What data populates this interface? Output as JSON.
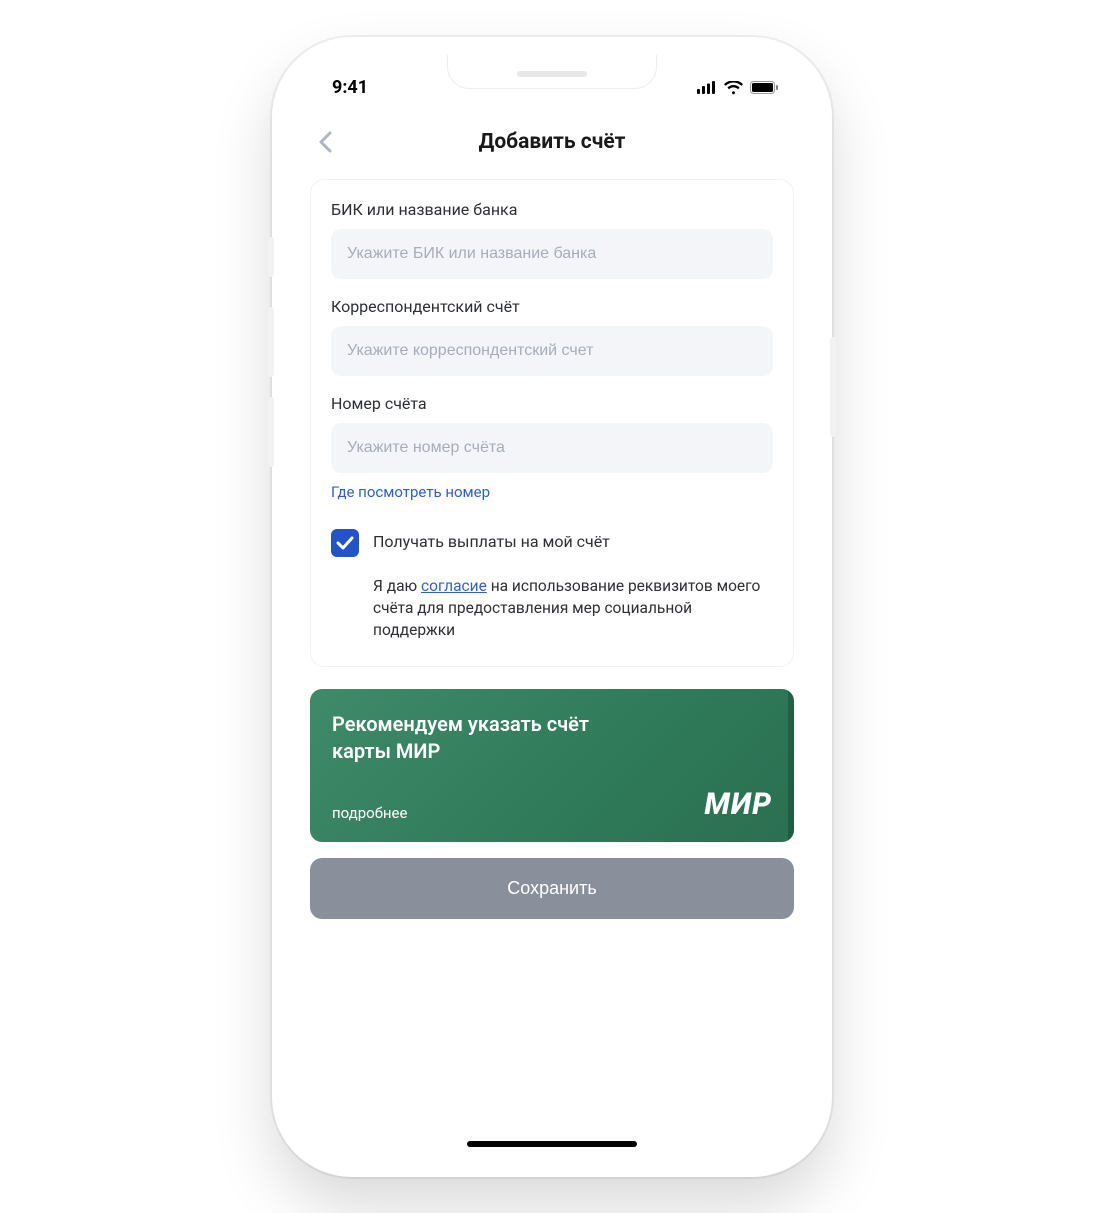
{
  "status": {
    "time": "9:41"
  },
  "header": {
    "title": "Добавить счёт"
  },
  "form": {
    "bank": {
      "label": "БИК или название банка",
      "placeholder": "Укажите БИК или название банка",
      "value": ""
    },
    "corr": {
      "label": "Корреспондентский счёт",
      "placeholder": "Укажите корреспондентский счет",
      "value": ""
    },
    "account": {
      "label": "Номер счёта",
      "placeholder": "Укажите номер счёта",
      "value": "",
      "help_link": "Где посмотреть номер"
    },
    "receive_payments": {
      "checked": true,
      "label": "Получать выплаты на мой счёт"
    },
    "consent": {
      "prefix": "Я даю ",
      "link": "согласие",
      "suffix": " на использование реквизитов моего счёта для предоставления мер социальной поддержки"
    }
  },
  "promo": {
    "title": "Рекомендуем указать счёт карты МИР",
    "more": "подробнее",
    "logo": "МИР"
  },
  "actions": {
    "save": "Сохранить"
  },
  "colors": {
    "accent_blue": "#2353c7",
    "link_blue": "#2e5fd1",
    "promo_green": "#2f7a59",
    "save_grey": "#8a8f9c"
  }
}
